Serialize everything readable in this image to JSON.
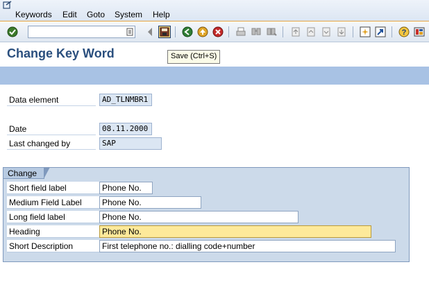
{
  "menu": [
    {
      "label": "Keywords"
    },
    {
      "label": "Edit"
    },
    {
      "label": "Goto"
    },
    {
      "label": "System"
    },
    {
      "label": "Help"
    }
  ],
  "toolbar": {
    "command_value": "",
    "tooltip": "Save   (Ctrl+S)"
  },
  "page": {
    "title": "Change Key Word"
  },
  "header_fields": {
    "data_element_label": "Data element",
    "data_element_value": "AD_TLNMBR1",
    "date_label": "Date",
    "date_value": "08.11.2000",
    "last_changed_label": "Last changed by",
    "last_changed_value": "SAP"
  },
  "change_group": {
    "title": "Change",
    "rows": [
      {
        "label": "Short field label",
        "value": "Phone No."
      },
      {
        "label": "Medium Field Label",
        "value": "Phone No."
      },
      {
        "label": "Long field label",
        "value": "Phone No."
      },
      {
        "label": "Heading",
        "value": "Phone No."
      },
      {
        "label": "Short Description",
        "value": "First telephone no.: dialling code+number"
      }
    ]
  },
  "colors": {
    "title": "#2a4f7e",
    "app_toolbar": "#a8c2e4",
    "focus_field": "#fde99a"
  },
  "icons": [
    "enter-icon",
    "back-icon",
    "save-icon",
    "green-arrow-icon",
    "exit-icon",
    "cancel-icon",
    "print-icon",
    "find-icon",
    "find-next-icon",
    "first-page-icon",
    "previous-page-icon",
    "next-page-icon",
    "last-page-icon",
    "new-session-icon",
    "shortcut-icon",
    "help-icon",
    "layout-icon"
  ]
}
